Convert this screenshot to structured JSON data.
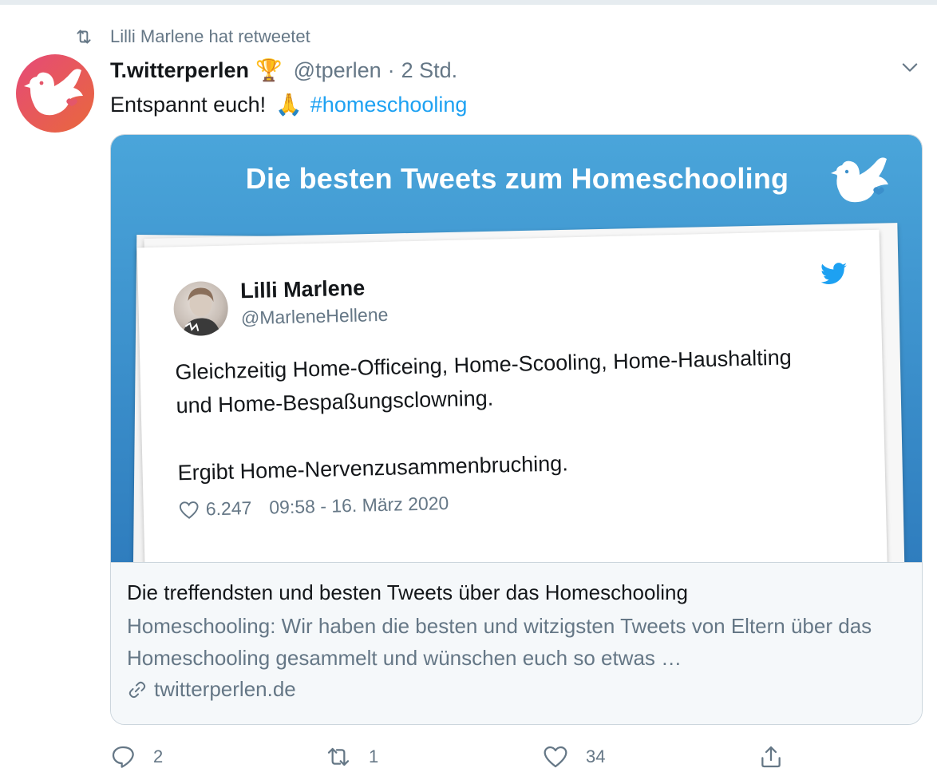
{
  "retweet_context": {
    "text": "Lilli Marlene hat retweetet"
  },
  "tweet": {
    "display_name": "T.witterperlen",
    "badge_emoji": "🏆",
    "handle": "@tperlen",
    "separator": "·",
    "time": "2 Std.",
    "text": "Entspannt euch!",
    "emoji": "🙏",
    "hashtag": "#homeschooling"
  },
  "card": {
    "image_headline": "Die besten Tweets zum Homeschooling",
    "embedded_tweet": {
      "name": "Lilli Marlene",
      "handle": "@MarleneHellene",
      "line1": "Gleichzeitig Home-Officeing, Home-Scooling, Home-Haushalting",
      "line2": "und Home-Bespaßungsclowning.",
      "line3": "Ergibt Home-Nervenzusammenbruching.",
      "likes": "6.247",
      "timestamp": "09:58 - 16. März 2020"
    },
    "title": "Die treffendsten und besten Tweets über das Homeschooling",
    "description": "Homeschooling: Wir haben die besten und witzigsten Tweets von Eltern über das Homeschooling gesammelt und wünschen euch so etwas …",
    "domain": "twitterperlen.de"
  },
  "actions": {
    "reply_count": "2",
    "retweet_count": "1",
    "like_count": "34"
  },
  "colors": {
    "accent": "#1da1f2",
    "secondary_text": "#657786",
    "card_blue": "#3b8fcb"
  }
}
